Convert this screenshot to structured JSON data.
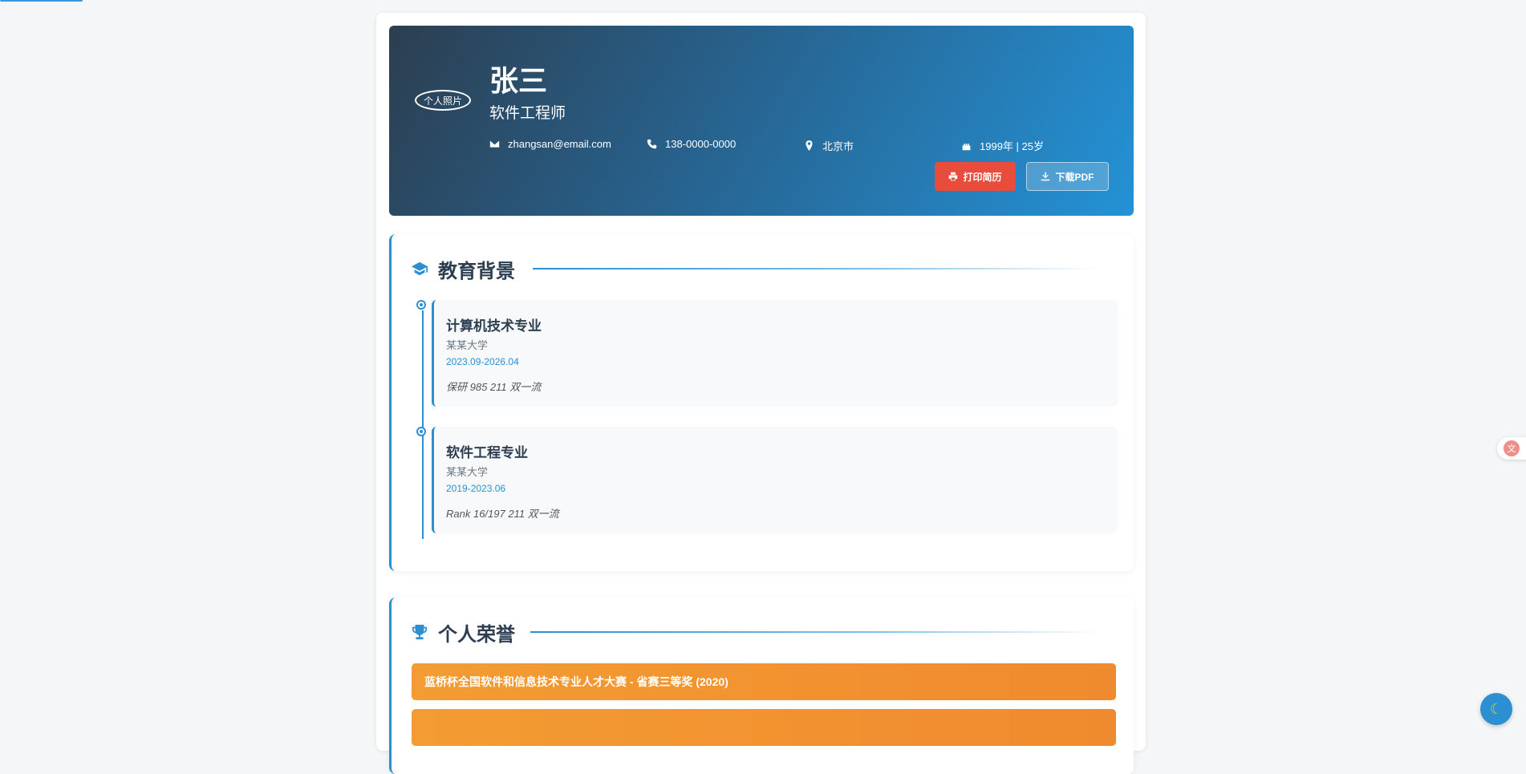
{
  "header": {
    "photo_alt": "个人照片",
    "name": "张三",
    "title": "软件工程师",
    "contacts": {
      "email": "zhangsan@email.com",
      "phone": "138-0000-0000",
      "location": "北京市",
      "birth": "1999年 | 25岁"
    },
    "print_label": "打印简历",
    "pdf_label": "下载PDF"
  },
  "education": {
    "title": "教育背景",
    "items": [
      {
        "major": "计算机技术专业",
        "school": "某某大学",
        "date": "2023.09-2026.04",
        "note": "保研 985 211 双一流"
      },
      {
        "major": "软件工程专业",
        "school": "某某大学",
        "date": "2019-2023.06",
        "note": "Rank 16/197 211 双一流"
      }
    ]
  },
  "honors": {
    "title": "个人荣誉",
    "items": [
      {
        "label": "蓝桥杯全国软件和信息技术专业人才大赛 - 省赛三等奖 (2020)"
      },
      {
        "label": ""
      }
    ]
  },
  "widgets": {
    "translate_icon": "translate-icon",
    "theme_icon": "moon-icon"
  },
  "colors": {
    "accent": "#2b8fd2",
    "header_start": "#2c3e50",
    "header_end": "#2492d6",
    "print_button": "#e74c3c",
    "honor": "#f39c33"
  }
}
